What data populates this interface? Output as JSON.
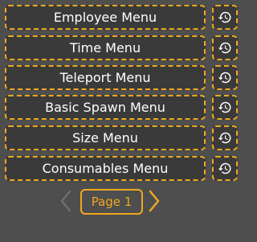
{
  "menu": {
    "items": [
      {
        "label": "Employee Menu",
        "history_icon": "history-icon"
      },
      {
        "label": "Time Menu",
        "history_icon": "history-icon"
      },
      {
        "label": "Teleport Menu",
        "history_icon": "history-icon"
      },
      {
        "label": "Basic Spawn Menu",
        "history_icon": "history-icon"
      },
      {
        "label": "Size Menu",
        "history_icon": "history-icon"
      },
      {
        "label": "Consumables Menu",
        "history_icon": "history-icon"
      }
    ]
  },
  "pagination": {
    "page_label": "Page 1",
    "prev_icon": "chevron-left-icon",
    "next_icon": "chevron-right-icon"
  },
  "colors": {
    "background": "#4e4e4e",
    "button_fill": "#3a3a3a",
    "accent": "#f0a81e",
    "text": "#ffffff",
    "disabled_arrow": "#6e6e6e"
  }
}
